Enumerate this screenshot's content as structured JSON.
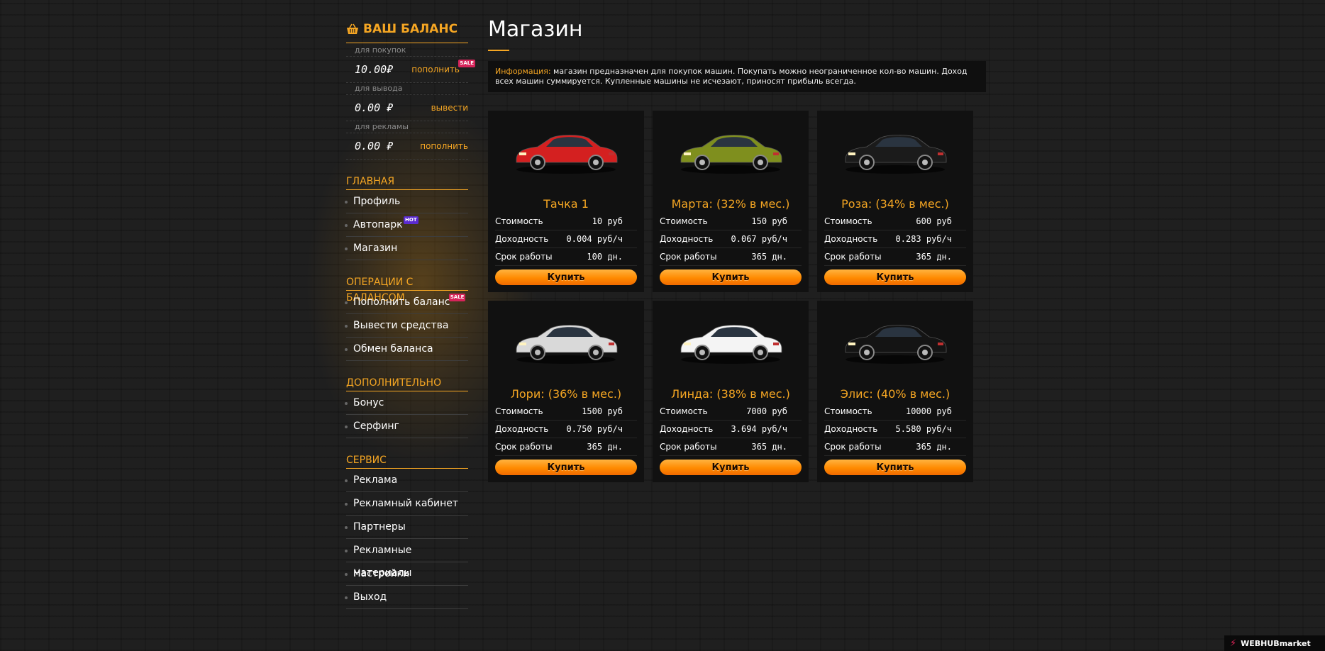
{
  "balance": {
    "title": "ВАШ БАЛАНС",
    "rows": [
      {
        "label": "для покупок",
        "amount": "10.00₽",
        "action": "пополнить",
        "badge": "SALE"
      },
      {
        "label": "для вывода",
        "amount": "0.00 ₽",
        "action": "вывести",
        "badge": ""
      },
      {
        "label": "для рекламы",
        "amount": "0.00 ₽",
        "action": "пополнить",
        "badge": ""
      }
    ]
  },
  "nav": [
    {
      "heading": "ГЛАВНАЯ",
      "items": [
        {
          "label": "Профиль",
          "badge": ""
        },
        {
          "label": "Автопарк",
          "badge": "HOT"
        },
        {
          "label": "Магазин",
          "badge": ""
        }
      ]
    },
    {
      "heading": "ОПЕРАЦИИ С БАЛАНСОМ",
      "items": [
        {
          "label": "Пополнить баланс",
          "badge": "SALE"
        },
        {
          "label": "Вывести средства",
          "badge": ""
        },
        {
          "label": "Обмен баланса",
          "badge": ""
        }
      ]
    },
    {
      "heading": "ДОПОЛНИТЕЛЬНО",
      "items": [
        {
          "label": "Бонус",
          "badge": ""
        },
        {
          "label": "Серфинг",
          "badge": ""
        }
      ]
    },
    {
      "heading": "СЕРВИС",
      "items": [
        {
          "label": "Реклама",
          "badge": ""
        },
        {
          "label": "Рекламный кабинет",
          "badge": ""
        },
        {
          "label": "Партнеры",
          "badge": ""
        },
        {
          "label": "Рекламные материалы",
          "badge": ""
        },
        {
          "label": "Настройки",
          "badge": ""
        },
        {
          "label": "Выход",
          "badge": ""
        }
      ]
    }
  ],
  "main": {
    "title": "Магазин",
    "info_label": "Информация:",
    "info_text": " магазин предназначен для покупок машин. Покупать можно неограниченное кол-во машин. Доход всех машин суммируется. Купленные машины не исчезают, приносят прибыль всегда."
  },
  "stat_labels": {
    "cost": "Стоимость",
    "income": "Доходность",
    "term": "Срок работы"
  },
  "buy_label": "Купить",
  "cars": [
    {
      "name": "Тачка 1",
      "cost": "10 руб",
      "income": "0.004 руб/ч",
      "term": "100 дн.",
      "color": "#d42020"
    },
    {
      "name": "Марта: (32% в мес.)",
      "cost": "150 руб",
      "income": "0.067 руб/ч",
      "term": "365 дн.",
      "color": "#7f8f1e"
    },
    {
      "name": "Роза: (34% в мес.)",
      "cost": "600 руб",
      "income": "0.283 руб/ч",
      "term": "365 дн.",
      "color": "#1b1b1b"
    },
    {
      "name": "Лори: (36% в мес.)",
      "cost": "1500 руб",
      "income": "0.750 руб/ч",
      "term": "365 дн.",
      "color": "#d9d9d9"
    },
    {
      "name": "Линда: (38% в мес.)",
      "cost": "7000 руб",
      "income": "3.694 руб/ч",
      "term": "365 дн.",
      "color": "#f4f4f4"
    },
    {
      "name": "Элис: (40% в мес.)",
      "cost": "10000 руб",
      "income": "5.580 руб/ч",
      "term": "365 дн.",
      "color": "#141414"
    }
  ],
  "watermark": "WEBHUBmarket"
}
